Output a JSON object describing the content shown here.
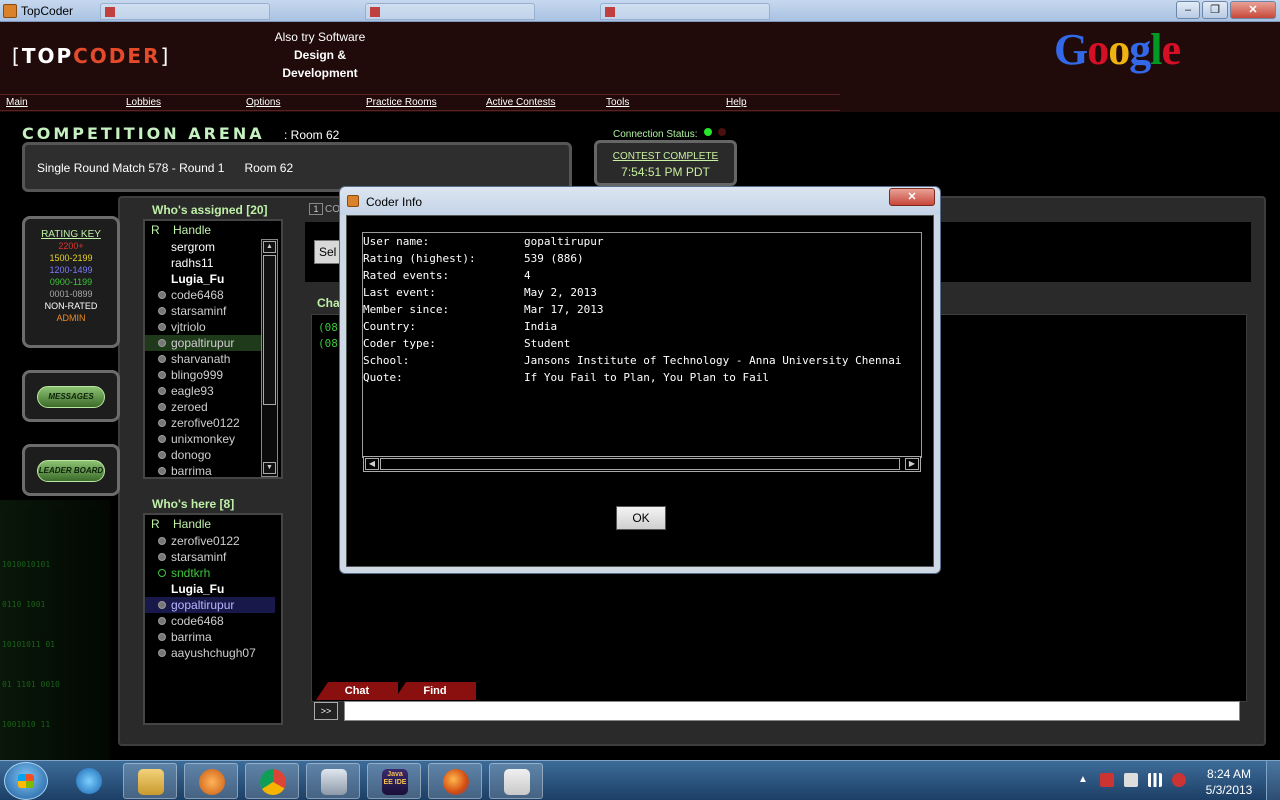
{
  "window": {
    "title": "TopCoder",
    "controls": {
      "minimize": "–",
      "maximize": "❐",
      "close": "✕"
    }
  },
  "header": {
    "logo": {
      "open": "[",
      "top": "TOP",
      "coder": "CODER",
      "close": "]"
    },
    "also_try": [
      "Also try Software",
      "Design &",
      "Development"
    ],
    "google": {
      "letters": [
        "G",
        "o",
        "o",
        "g",
        "l",
        "e"
      ],
      "colors": [
        "#3369e8",
        "#d50f25",
        "#eeb211",
        "#3369e8",
        "#009925",
        "#d50f25"
      ]
    }
  },
  "menu": [
    "Main",
    "Lobbies",
    "Options",
    "Practice Rooms",
    "Active Contests",
    "Tools",
    "Help"
  ],
  "arena": {
    "title": "COMPETITION ARENA",
    "room": ": Room 62",
    "connection_status": "Connection Status:",
    "match": "Single Round Match 578 - Round 1      Room 62",
    "contest_status": "CONTEST COMPLETE",
    "contest_time": "7:54:51 PM PDT"
  },
  "rating_key": {
    "title": "RATING KEY",
    "levels": [
      {
        "label": "2200+",
        "color": "#e3322a"
      },
      {
        "label": "1500-2199",
        "color": "#e8d22a"
      },
      {
        "label": "1200-1499",
        "color": "#7a7aff"
      },
      {
        "label": "0900-1199",
        "color": "#3dc63a"
      },
      {
        "label": "0001-0899",
        "color": "#a8a8a8"
      },
      {
        "label": "NON-RATED",
        "color": "#ffffff"
      },
      {
        "label": "ADMIN",
        "color": "#ee8a20"
      }
    ]
  },
  "side_buttons": {
    "messages": "MESSAGES",
    "leaderboard": "LEADER BOARD"
  },
  "assigned": {
    "title": "Who's assigned [20]",
    "col_r": "R",
    "col_handle": "Handle",
    "rows": [
      "sergrom",
      "radhs11",
      "Lugia_Fu",
      "code6468",
      "starsaminf",
      "vjtriolo",
      "gopaltirupur",
      "sharvanath",
      "blingo999",
      "eagle93",
      "zeroed",
      "zerofive0122",
      "unixmonkey",
      "donogo",
      "barrima"
    ]
  },
  "here": {
    "title": "Who's here [8]",
    "col_r": "R",
    "col_handle": "Handle",
    "rows": [
      "zerofive0122",
      "starsaminf",
      "sndtkrh",
      "Lugia_Fu",
      "gopaltirupur",
      "code6468",
      "barrima",
      "aayushchugh07"
    ]
  },
  "chat": {
    "tab_number": "1",
    "tab_text": "CO",
    "select_label": "Sel",
    "label": "Cha",
    "lines": [
      "(08",
      "(08"
    ],
    "tabs": [
      "Chat",
      "Find"
    ],
    "go": ">>"
  },
  "matrix_lines": [
    "1010010101",
    "0110 1001",
    "10101011 01",
    "01 1101 0010",
    "1001010 11"
  ],
  "dialog": {
    "title": "Coder Info",
    "fields": [
      {
        "key": "User name:",
        "value": "gopaltirupur"
      },
      {
        "key": "Rating (highest):",
        "value": "539 (886)"
      },
      {
        "key": "Rated events:",
        "value": "4"
      },
      {
        "key": "Last event:",
        "value": "May 2, 2013"
      },
      {
        "key": "Member since:",
        "value": "Mar 17, 2013"
      },
      {
        "key": "Country:",
        "value": "India"
      },
      {
        "key": "Coder type:",
        "value": "Student"
      },
      {
        "key": "School:",
        "value": "Jansons Institute of Technology - Anna University Chennai"
      },
      {
        "key": "Quote:",
        "value": "If You Fail to Plan, You Plan to Fail"
      }
    ],
    "ok": "OK",
    "close": "✕"
  },
  "taskbar": {
    "apps": [
      "internet-explorer",
      "file-explorer",
      "media-player",
      "chrome",
      "video-app",
      "java-ee-ide",
      "firefox",
      "java"
    ],
    "java_ide_label": "Java EE IDE",
    "time": "8:24 AM",
    "date": "5/3/2013",
    "tray_arrow": "▲"
  }
}
